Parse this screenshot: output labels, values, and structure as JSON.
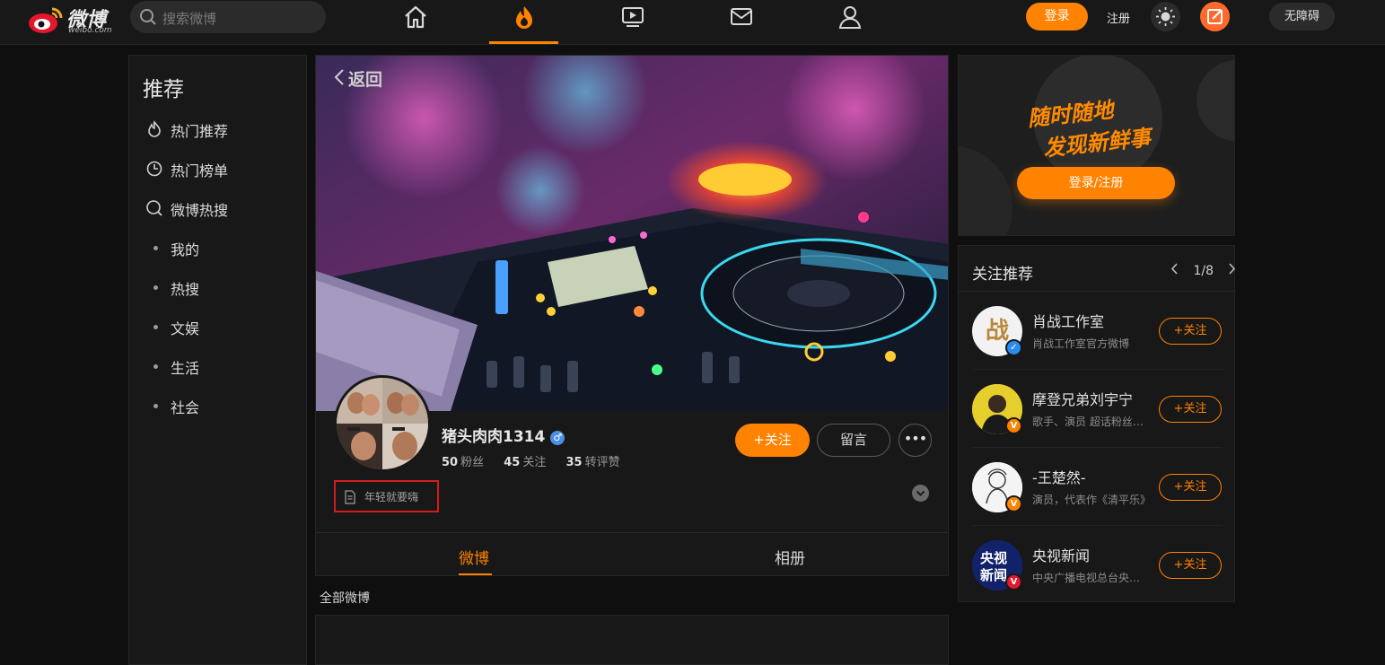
{
  "header": {
    "logo_text": "微博",
    "logo_sub": "weibo.com",
    "search_placeholder": "搜索微博",
    "login_label": "登录",
    "register_label": "注册",
    "accessibility_label": "无障碍",
    "nav_icons": [
      "home-icon",
      "hot-icon",
      "video-icon",
      "message-icon",
      "profile-icon"
    ],
    "active_nav": "hot-icon",
    "accent_color": "#ff8200"
  },
  "sidebar": {
    "title": "推荐",
    "items": [
      {
        "label": "热门推荐",
        "icon": "fire-icon"
      },
      {
        "label": "热门榜单",
        "icon": "ranking-icon"
      },
      {
        "label": "微博热搜",
        "icon": "hot-search-icon"
      },
      {
        "label": "我的",
        "icon": "dot"
      },
      {
        "label": "热搜",
        "icon": "dot"
      },
      {
        "label": "文娱",
        "icon": "dot"
      },
      {
        "label": "生活",
        "icon": "dot"
      },
      {
        "label": "社会",
        "icon": "dot"
      }
    ]
  },
  "profile": {
    "back_label": "返回",
    "name": "猪头肉肉1314",
    "gender_symbol": "♂",
    "stats": [
      {
        "value": "50",
        "label": "粉丝"
      },
      {
        "value": "45",
        "label": "关注"
      },
      {
        "value": "35",
        "label": "转评赞"
      }
    ],
    "follow_label": "关注",
    "message_label": "留言",
    "more_label": "•••",
    "bio": "年轻就要嗨",
    "tabs": [
      {
        "label": "微博",
        "active": true
      },
      {
        "label": "相册",
        "active": false
      }
    ],
    "section_label": "全部微博"
  },
  "promo": {
    "slogan_line1": "随时随地",
    "slogan_line2": "发现新鲜事",
    "button_label": "登录/注册"
  },
  "recommend": {
    "title": "关注推荐",
    "pager": "1/8",
    "follow_label": "关注",
    "items": [
      {
        "name": "肖战工作室",
        "desc": "肖战工作室官方微博",
        "badge": "blue",
        "avatar_text": "战"
      },
      {
        "name": "摩登兄弟刘宇宁",
        "desc": "歌手、演员 超话粉丝大咖",
        "badge": "orange",
        "avatar_text": ""
      },
      {
        "name": "-王楚然-",
        "desc": "演员，代表作《清平乐》",
        "badge": "orange",
        "avatar_text": ""
      },
      {
        "name": "央视新闻",
        "desc": "中央广播电视总台央视新闻",
        "badge": "red",
        "avatar_text": "央视新闻"
      }
    ]
  }
}
